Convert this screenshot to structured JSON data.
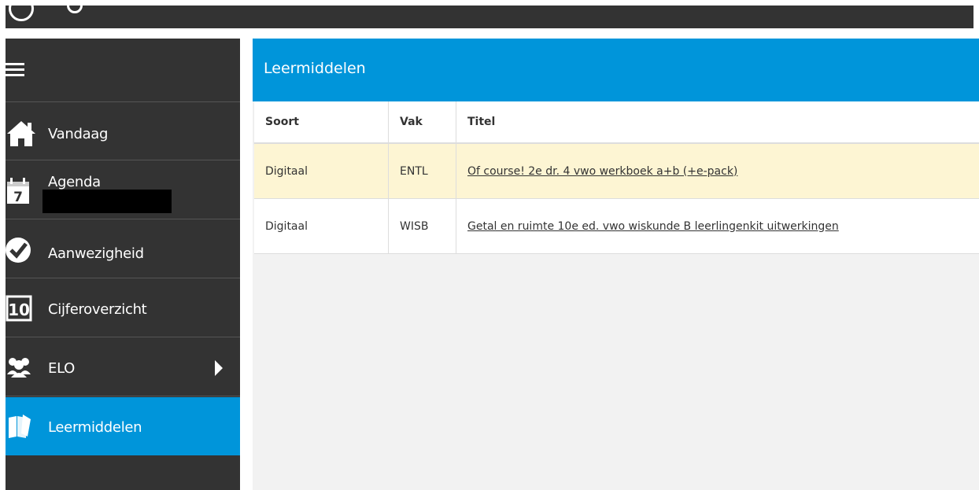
{
  "sidebar": {
    "items": [
      {
        "label": "Vandaag",
        "icon": "home-icon"
      },
      {
        "label": "Agenda",
        "icon": "calendar-icon",
        "icon_text": "7"
      },
      {
        "label": "Aanwezigheid",
        "icon": "checkmark-icon"
      },
      {
        "label": "Cijferoverzicht",
        "icon": "grade-icon",
        "icon_text": "10"
      },
      {
        "label": "ELO",
        "icon": "people-icon"
      },
      {
        "label": "Leermiddelen",
        "icon": "books-icon"
      }
    ],
    "active_color": "#0095da"
  },
  "main": {
    "title": "Leermiddelen",
    "table": {
      "headers": [
        "Soort",
        "Vak",
        "Titel"
      ],
      "rows": [
        {
          "soort": "Digitaal",
          "vak": "ENTL",
          "titel": "Of course! 2e dr. 4 vwo werkboek a+b (+e-pack)"
        },
        {
          "soort": "Digitaal",
          "vak": "WISB",
          "titel": "Getal en ruimte 10e ed. vwo wiskunde B leerlingenkit uitwerkingen"
        }
      ]
    }
  },
  "colors": {
    "sidebar_bg": "#333333",
    "accent": "#0095da",
    "highlight_row": "#fdf5d3"
  }
}
